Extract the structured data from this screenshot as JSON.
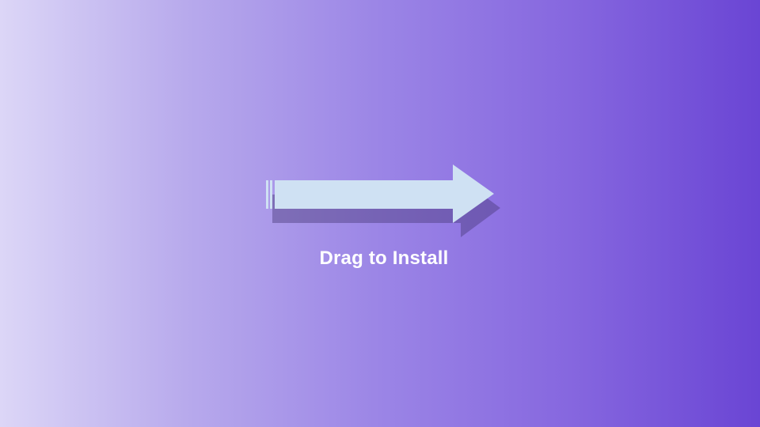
{
  "installer": {
    "instruction_label": "Drag to Install",
    "arrow_icon": "right-arrow-icon"
  },
  "colors": {
    "gradient_start": "#dcd6f7",
    "gradient_end": "#6a45d4",
    "arrow_fill": "#cfe1f3",
    "arrow_shadow": "#4a3a7a",
    "label_color": "#ffffff"
  }
}
